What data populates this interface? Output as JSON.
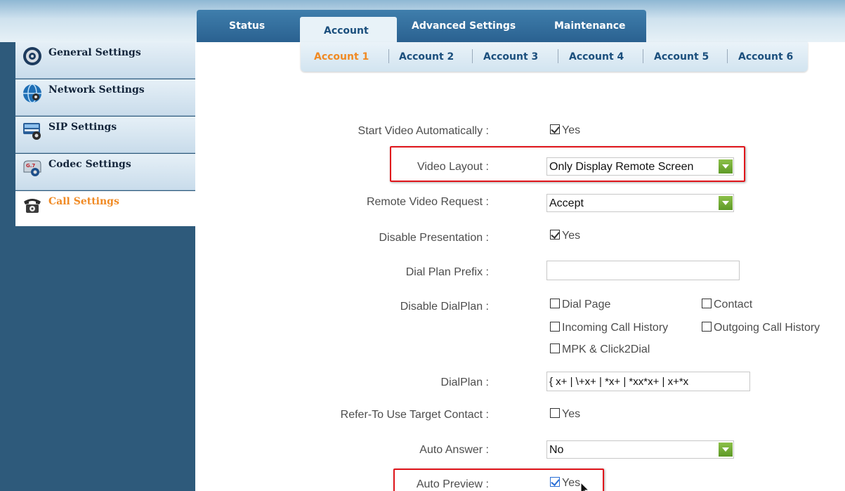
{
  "tabs": [
    "Status",
    "Account",
    "Advanced Settings",
    "Maintenance"
  ],
  "active_tab": "Account",
  "sidebar": {
    "items": [
      {
        "label": "General Settings",
        "icon": "gear-icon"
      },
      {
        "label": "Network Settings",
        "icon": "globe-gear-icon"
      },
      {
        "label": "SIP Settings",
        "icon": "sip-device-icon"
      },
      {
        "label": "Codec Settings",
        "icon": "codec-gear-icon"
      },
      {
        "label": "Call Settings",
        "icon": "telephone-icon"
      }
    ],
    "active": "Call Settings"
  },
  "subtabs": [
    "Account 1",
    "Account 2",
    "Account 3",
    "Account 4",
    "Account 5",
    "Account 6"
  ],
  "active_subtab": "Account 1",
  "form": {
    "start_video": {
      "label": "Start Video Automatically :",
      "option": "Yes",
      "checked": true
    },
    "video_layout": {
      "label": "Video Layout :",
      "value": "Only Display Remote Screen"
    },
    "remote_video_request": {
      "label": "Remote Video Request :",
      "value": "Accept"
    },
    "disable_presentation": {
      "label": "Disable Presentation :",
      "option": "Yes",
      "checked": true
    },
    "dial_plan_prefix": {
      "label": "Dial Plan Prefix :",
      "value": ""
    },
    "disable_dialplan": {
      "label": "Disable DialPlan :",
      "options": [
        {
          "label": "Dial Page",
          "checked": false
        },
        {
          "label": "Contact",
          "checked": false
        },
        {
          "label": "Incoming Call History",
          "checked": false
        },
        {
          "label": "Outgoing Call History",
          "checked": false
        },
        {
          "label": "MPK & Click2Dial",
          "checked": false
        }
      ]
    },
    "dialplan": {
      "label": "DialPlan :",
      "value": "{ x+ | \\+x+ | *x+ | *xx*x+ | x+*x"
    },
    "refer_to": {
      "label": "Refer-To Use Target Contact :",
      "option": "Yes",
      "checked": false
    },
    "auto_answer": {
      "label": "Auto Answer :",
      "value": "No"
    },
    "auto_preview": {
      "label": "Auto Preview :",
      "option": "Yes",
      "checked": true
    }
  },
  "colors": {
    "tab_bar": "#2a6190",
    "sidebar_bg": "#2e5a7b",
    "active_orange": "#f08a24",
    "tab_text": "#1b4f7d",
    "highlight_red": "#e0151b",
    "dropdown_green": "#6aa630"
  }
}
